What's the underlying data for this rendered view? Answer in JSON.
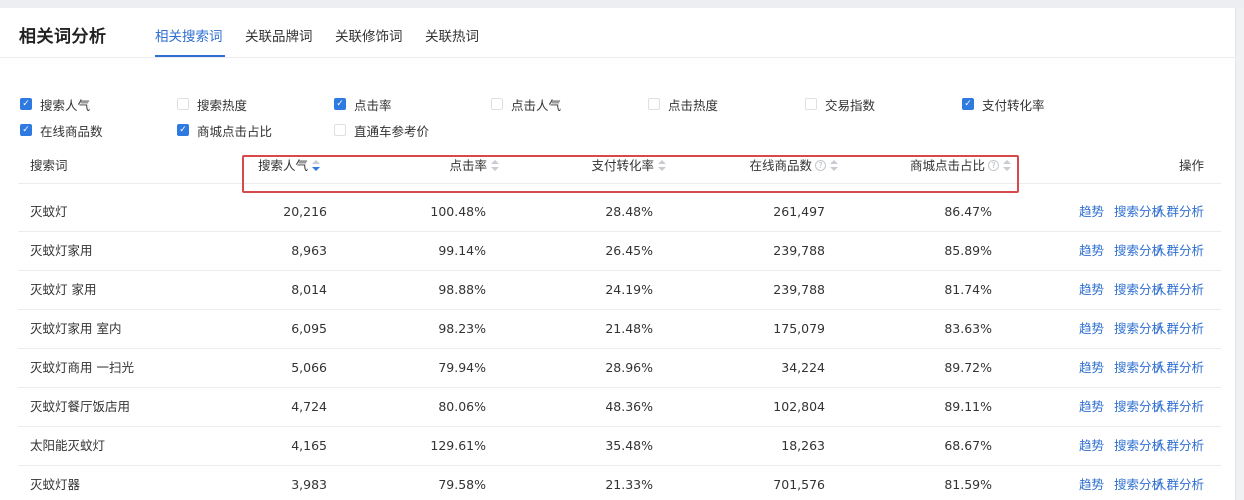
{
  "title": "相关词分析",
  "tabs": [
    {
      "label": "相关搜索词",
      "active": true
    },
    {
      "label": "关联品牌词",
      "active": false
    },
    {
      "label": "关联修饰词",
      "active": false
    },
    {
      "label": "关联热词",
      "active": false
    }
  ],
  "filters": [
    {
      "label": "搜索人气",
      "checked": true
    },
    {
      "label": "搜索热度",
      "checked": false
    },
    {
      "label": "点击率",
      "checked": true
    },
    {
      "label": "点击人气",
      "checked": false
    },
    {
      "label": "点击热度",
      "checked": false
    },
    {
      "label": "交易指数",
      "checked": false
    },
    {
      "label": "支付转化率",
      "checked": true
    },
    {
      "label": "在线商品数",
      "checked": true
    },
    {
      "label": "商城点击占比",
      "checked": true
    },
    {
      "label": "直通车参考价",
      "checked": false
    }
  ],
  "table": {
    "columns": {
      "keyword": "搜索词",
      "popularity": "搜索人气",
      "ctr": "点击率",
      "conversion": "支付转化率",
      "online": "在线商品数",
      "mall_ratio": "商城点击占比",
      "actions": "操作"
    },
    "help_glyph": "?",
    "action_labels": {
      "trend": "趋势",
      "search": "搜索分析",
      "crowd": "人群分析"
    },
    "rows": [
      {
        "keyword": "灭蚊灯",
        "popularity": "20,216",
        "ctr": "100.48%",
        "conversion": "28.48%",
        "online": "261,497",
        "mall_ratio": "86.47%"
      },
      {
        "keyword": "灭蚊灯家用",
        "popularity": "8,963",
        "ctr": "99.14%",
        "conversion": "26.45%",
        "online": "239,788",
        "mall_ratio": "85.89%"
      },
      {
        "keyword": "灭蚊灯 家用",
        "popularity": "8,014",
        "ctr": "98.88%",
        "conversion": "24.19%",
        "online": "239,788",
        "mall_ratio": "81.74%"
      },
      {
        "keyword": "灭蚊灯家用 室内",
        "popularity": "6,095",
        "ctr": "98.23%",
        "conversion": "21.48%",
        "online": "175,079",
        "mall_ratio": "83.63%"
      },
      {
        "keyword": "灭蚊灯商用 一扫光",
        "popularity": "5,066",
        "ctr": "79.94%",
        "conversion": "28.96%",
        "online": "34,224",
        "mall_ratio": "89.72%"
      },
      {
        "keyword": "灭蚊灯餐厅饭店用",
        "popularity": "4,724",
        "ctr": "80.06%",
        "conversion": "48.36%",
        "online": "102,804",
        "mall_ratio": "89.11%"
      },
      {
        "keyword": "太阳能灭蚊灯",
        "popularity": "4,165",
        "ctr": "129.61%",
        "conversion": "35.48%",
        "online": "18,263",
        "mall_ratio": "68.67%"
      },
      {
        "keyword": "灭蚊灯器",
        "popularity": "3,983",
        "ctr": "79.58%",
        "conversion": "21.33%",
        "online": "701,576",
        "mall_ratio": "81.59%"
      }
    ]
  },
  "colors": {
    "accent": "#2f6fd1",
    "highlight_border": "#d84a4a",
    "checkbox_checked": "#2f7ae0"
  }
}
